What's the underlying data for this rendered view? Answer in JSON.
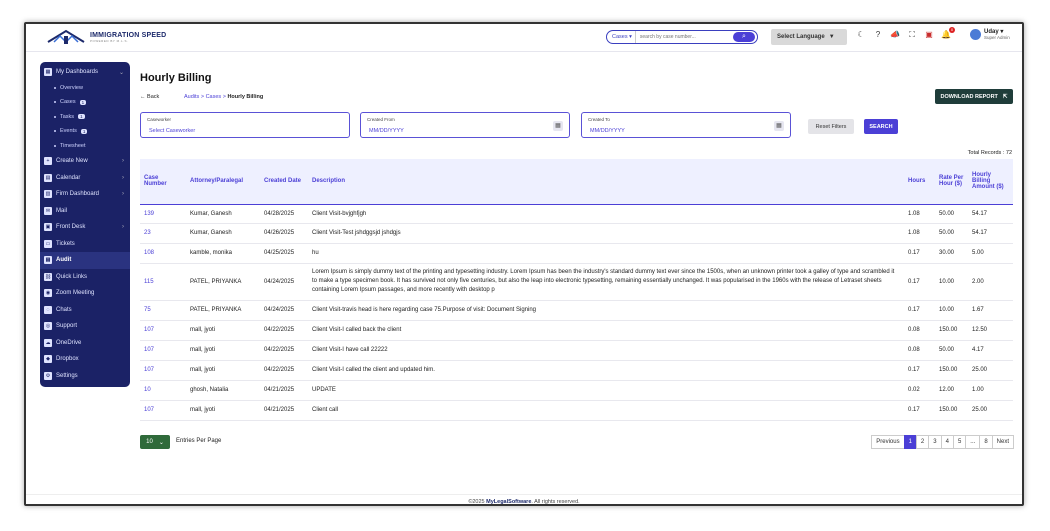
{
  "app": {
    "logo_text": "IMMIGRATION SPEED",
    "logo_sub": "POWERED BY M.L.S.",
    "search_type": "Cases",
    "search_placeholder": "search by case number...",
    "language_label": "Select Language",
    "user_name": "Uday",
    "user_role": "Super Admin",
    "notification_badge": "0"
  },
  "sidebar": {
    "items": [
      {
        "label": "My Dashboards",
        "icon": "grid-icon"
      },
      {
        "label": "Create New",
        "icon": "plus-icon"
      },
      {
        "label": "Calendar",
        "icon": "calendar-icon"
      },
      {
        "label": "Firm Dashboard",
        "icon": "building-icon"
      },
      {
        "label": "Mail",
        "icon": "mail-icon"
      },
      {
        "label": "Front Desk",
        "icon": "desk-icon"
      },
      {
        "label": "Tickets",
        "icon": "ticket-icon"
      },
      {
        "label": "Audit",
        "icon": "audit-icon"
      },
      {
        "label": "Quick Links",
        "icon": "link-icon"
      },
      {
        "label": "Zoom Meeting",
        "icon": "video-icon"
      },
      {
        "label": "Chats",
        "icon": "chat-icon"
      },
      {
        "label": "Support",
        "icon": "support-icon"
      },
      {
        "label": "OneDrive",
        "icon": "cloud-icon"
      },
      {
        "label": "Dropbox",
        "icon": "dropbox-icon"
      },
      {
        "label": "Settings",
        "icon": "gear-icon"
      }
    ],
    "subitems": [
      {
        "label": "Overview",
        "badge": ""
      },
      {
        "label": "Cases",
        "badge": "1"
      },
      {
        "label": "Tasks",
        "badge": "1"
      },
      {
        "label": "Events",
        "badge": "1"
      },
      {
        "label": "Timesheet",
        "badge": ""
      }
    ]
  },
  "page": {
    "title": "Hourly Billing",
    "back_label": "Back",
    "breadcrumb_1": "Audits",
    "breadcrumb_2": "Cases",
    "breadcrumb_3": "Hourly Billing",
    "download_label": "DOWNLOAD REPORT"
  },
  "filters": {
    "caseworker_label": "Caseworker",
    "caseworker_value": "Select Caseworker",
    "from_label": "Created From",
    "from_value": "MM/DD/YYYY",
    "to_label": "Created To",
    "to_value": "MM/DD/YYYY",
    "reset_label": "Reset Filters",
    "search_label": "SEARCH"
  },
  "table": {
    "total_records": "Total Records : 72",
    "headers": {
      "case": "Case Number",
      "attorney": "Attorney/Paralegal",
      "created": "Created Date",
      "description": "Description",
      "hours": "Hours",
      "rate": "Rate Per Hour ($)",
      "amount": "Hourly Billing Amount ($)"
    },
    "rows": [
      {
        "case": "139",
        "attorney": "Kumar, Ganesh",
        "date": "04/28/2025",
        "desc": "Client Visit-bvjghfjgh",
        "hours": "1.08",
        "rate": "50.00",
        "amount": "54.17"
      },
      {
        "case": "23",
        "attorney": "Kumar, Ganesh",
        "date": "04/26/2025",
        "desc": "Client Visit-Test jshdggsjd jshdgjs",
        "hours": "1.08",
        "rate": "50.00",
        "amount": "54.17"
      },
      {
        "case": "108",
        "attorney": "kamble, monika",
        "date": "04/25/2025",
        "desc": "hu",
        "hours": "0.17",
        "rate": "30.00",
        "amount": "5.00"
      },
      {
        "case": "115",
        "attorney": "PATEL, PRIYANKA",
        "date": "04/24/2025",
        "desc": "Lorem Ipsum is simply dummy text of the printing and typesetting industry. Lorem Ipsum has been the industry's standard dummy text ever since the 1500s, when an unknown printer took a galley of type and scrambled it to make a type specimen book. It has survived not only five centuries, but also the leap into electronic typesetting, remaining essentially unchanged. It was popularised in the 1960s with the release of Letraset sheets containing Lorem Ipsum passages, and more recently with desktop p",
        "hours": "0.17",
        "rate": "10.00",
        "amount": "2.00"
      },
      {
        "case": "75",
        "attorney": "PATEL, PRIYANKA",
        "date": "04/24/2025",
        "desc": "Client Visit-travis head is here regarding case 75.Purpose of visit: Document Signing",
        "hours": "0.17",
        "rate": "10.00",
        "amount": "1.67"
      },
      {
        "case": "107",
        "attorney": "mall, jyoti",
        "date": "04/22/2025",
        "desc": "Client Visit-I called back the client",
        "hours": "0.08",
        "rate": "150.00",
        "amount": "12.50"
      },
      {
        "case": "107",
        "attorney": "mall, jyoti",
        "date": "04/22/2025",
        "desc": "Client Visit-I have call 22222",
        "hours": "0.08",
        "rate": "50.00",
        "amount": "4.17"
      },
      {
        "case": "107",
        "attorney": "mall, jyoti",
        "date": "04/22/2025",
        "desc": "Client Visit-I called the client and updated him.",
        "hours": "0.17",
        "rate": "150.00",
        "amount": "25.00"
      },
      {
        "case": "10",
        "attorney": "ghosh, Natalia",
        "date": "04/21/2025",
        "desc": "UPDATE",
        "hours": "0.02",
        "rate": "12.00",
        "amount": "1.00"
      },
      {
        "case": "107",
        "attorney": "mall, jyoti",
        "date": "04/21/2025",
        "desc": "Client call",
        "hours": "0.17",
        "rate": "150.00",
        "amount": "25.00"
      }
    ]
  },
  "pagination": {
    "page_size": "10",
    "page_size_label": "Entries Per Page",
    "previous": "Previous",
    "pages": [
      "1",
      "2",
      "3",
      "4",
      "5",
      "...",
      "8"
    ],
    "next": "Next"
  },
  "footer": {
    "year": "©2025",
    "brand": "MyLegalSoftware",
    "rights": "All rights reserved."
  }
}
